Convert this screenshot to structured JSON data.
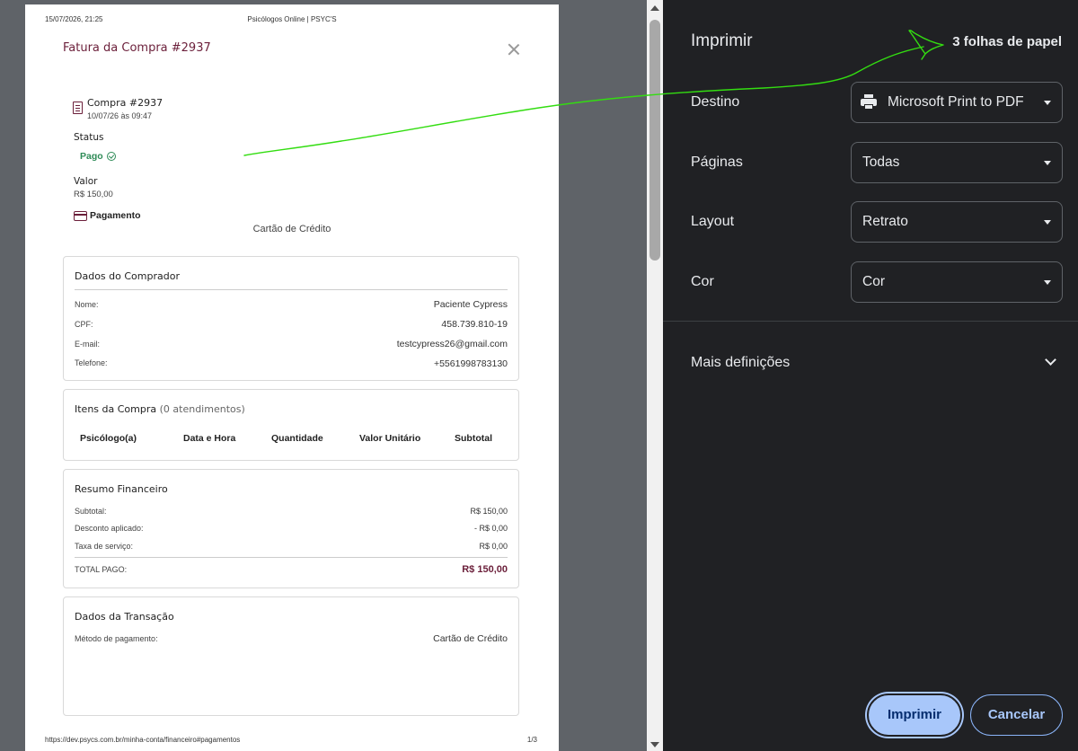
{
  "page": {
    "header_date": "15/07/2026, 21:25",
    "header_title": "Psicólogos Online | PSYC'S",
    "invoice_title": "Fatura da Compra #2937",
    "purchase": {
      "number": "Compra #2937",
      "date": "10/07/26 às 09:47",
      "status_label": "Status",
      "status_value": "Pago",
      "valor_label": "Valor",
      "valor_value": "R$ 150,00",
      "pagamento_label": "Pagamento",
      "pagamento_value": "Cartão de Crédito"
    },
    "buyer": {
      "title": "Dados do Comprador",
      "rows": [
        {
          "k": "Nome:",
          "v": "Paciente Cypress"
        },
        {
          "k": "CPF:",
          "v": "458.739.810-19"
        },
        {
          "k": "E-mail:",
          "v": "testcypress26@gmail.com"
        },
        {
          "k": "Telefone:",
          "v": "+5561998783130"
        }
      ]
    },
    "items": {
      "title": "Itens da Compra",
      "count": "(0 atendimentos)",
      "columns": [
        "Psicólogo(a)",
        "Data e Hora",
        "Quantidade",
        "Valor Unitário",
        "Subtotal"
      ]
    },
    "summary": {
      "title": "Resumo Financeiro",
      "rows": [
        {
          "k": "Subtotal:",
          "v": "R$ 150,00"
        },
        {
          "k": "Desconto aplicado:",
          "v": "- R$ 0,00"
        },
        {
          "k": "Taxa de serviço:",
          "v": "R$ 0,00"
        }
      ],
      "total_label": "TOTAL PAGO:",
      "total_value": "R$ 150,00"
    },
    "transaction": {
      "title": "Dados da Transação",
      "method_label": "Método de pagamento:",
      "method_value": "Cartão de Crédito"
    },
    "footer_url": "https://dev.psycs.com.br/minha-conta/financeiro#pagamentos",
    "footer_page": "1/3"
  },
  "panel": {
    "title": "Imprimir",
    "sheets": "3 folhas de papel",
    "destino": {
      "label": "Destino",
      "value": "Microsoft Print to PDF"
    },
    "paginas": {
      "label": "Páginas",
      "value": "Todas"
    },
    "layout": {
      "label": "Layout",
      "value": "Retrato"
    },
    "cor": {
      "label": "Cor",
      "value": "Cor"
    },
    "more_settings": "Mais definições",
    "print_button": "Imprimir",
    "cancel_button": "Cancelar"
  },
  "colors": {
    "panel_bg": "#202124",
    "accent": "#a8c7fa",
    "brand": "#6b1f3a",
    "paid": "#2e8b57",
    "annotation": "#33dd11"
  }
}
